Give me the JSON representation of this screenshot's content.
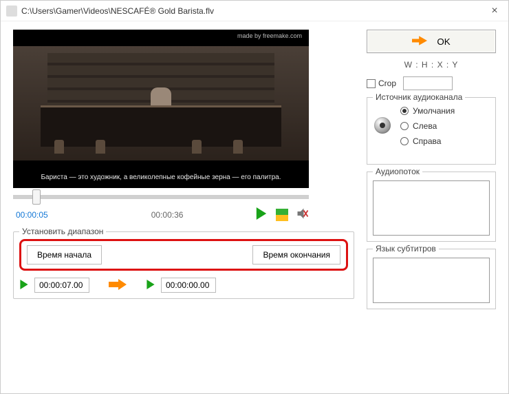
{
  "titlebar": {
    "path": "C:\\Users\\Gamer\\Videos\\NESCAFÉ® Gold Barista.flv"
  },
  "video": {
    "watermark": "made by freemake.com",
    "subtitle": "Бариста — это художник, а великолепные кофейные зерна — его палитра."
  },
  "times": {
    "current": "00:00:05",
    "total": "00:00:36"
  },
  "range": {
    "legend": "Установить диапазон",
    "start_btn": "Время начала",
    "end_btn": "Время окончания",
    "start_time": "00:00:07.00",
    "end_time": "00:00:00.00"
  },
  "right": {
    "ok": "OK",
    "whxy": "W : H : X : Y",
    "crop_label": "Сrop",
    "crop_value": "",
    "audio_source": {
      "legend": "Источник аудиоканала",
      "options": {
        "default": "Умолчания",
        "left": "Слева",
        "right": "Справа"
      },
      "selected": "default"
    },
    "audio_stream_legend": "Аудиопоток",
    "subs_legend": "Язык субтитров"
  }
}
